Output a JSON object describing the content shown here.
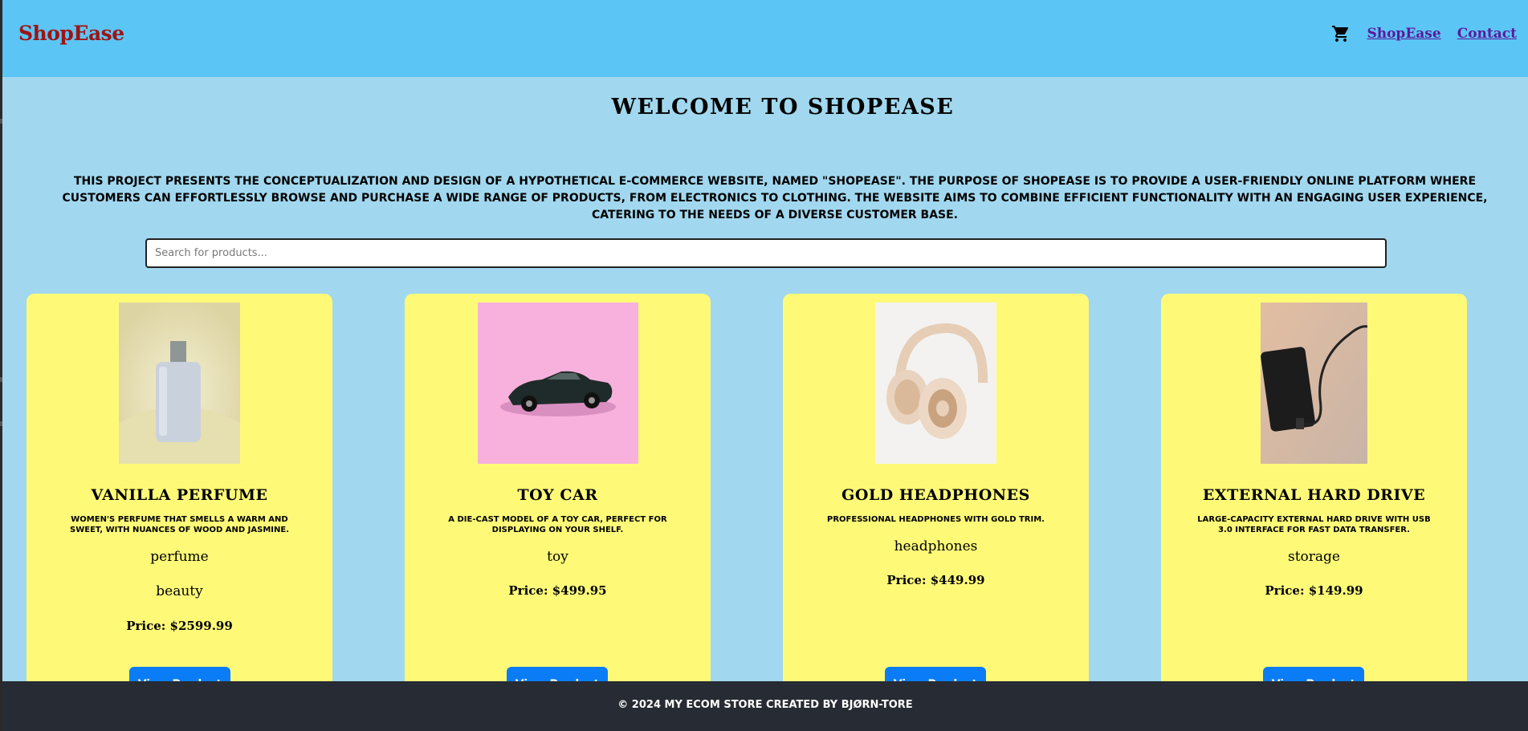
{
  "header": {
    "brand": "ShopEase",
    "cart_icon": "shopping-cart-icon",
    "nav": [
      {
        "label": "ShopEase"
      },
      {
        "label": "Contact"
      }
    ]
  },
  "hero": {
    "title": "WELCOME TO SHOPEASE",
    "intro": "This project presents the conceptualization and design of a hypothetical e-commerce website, named \"ShopEase\". The purpose of ShopEase is to provide a user-friendly online platform where customers can effortlessly browse and purchase a wide range of products, from electronics to clothing. The website aims to combine efficient functionality with an engaging user experience, catering to the needs of a diverse customer base."
  },
  "search": {
    "placeholder": "Search for products..."
  },
  "products": [
    {
      "name": "Vanilla Perfume",
      "description": "Women's perfume that smells a warm and sweet, with nuances of wood and jasmine.",
      "tags": [
        "perfume",
        "beauty"
      ],
      "price": "Price: $2599.99",
      "button": "View Product",
      "image": "perfume-bottle-image"
    },
    {
      "name": "Toy Car",
      "description": "A die-cast model of a toy car, perfect for displaying on your shelf.",
      "tags": [
        "toy"
      ],
      "price": "Price: $499.95",
      "button": "View Product",
      "image": "toy-car-image"
    },
    {
      "name": "Gold Headphones",
      "description": "Professional headphones with gold trim.",
      "tags": [
        "headphones"
      ],
      "price": "Price: $449.99",
      "button": "View Product",
      "image": "headphones-image"
    },
    {
      "name": "External Hard Drive",
      "description": "Large-capacity external hard drive with USB 3.0 interface for fast data transfer.",
      "tags": [
        "storage"
      ],
      "price": "Price: $149.99",
      "button": "View Product",
      "image": "hard-drive-image"
    }
  ],
  "footer": {
    "copyright": "© 2024 My Ecom Store created by Bjørn-Tore"
  },
  "colors": {
    "header_bg": "#5bc5f5",
    "page_bg": "#a1d8ef",
    "card_bg": "#fefa78",
    "brand": "#9e1414",
    "nav_link": "#5b1a9e",
    "button": "#0a7cf5",
    "footer_bg": "#272b33"
  }
}
